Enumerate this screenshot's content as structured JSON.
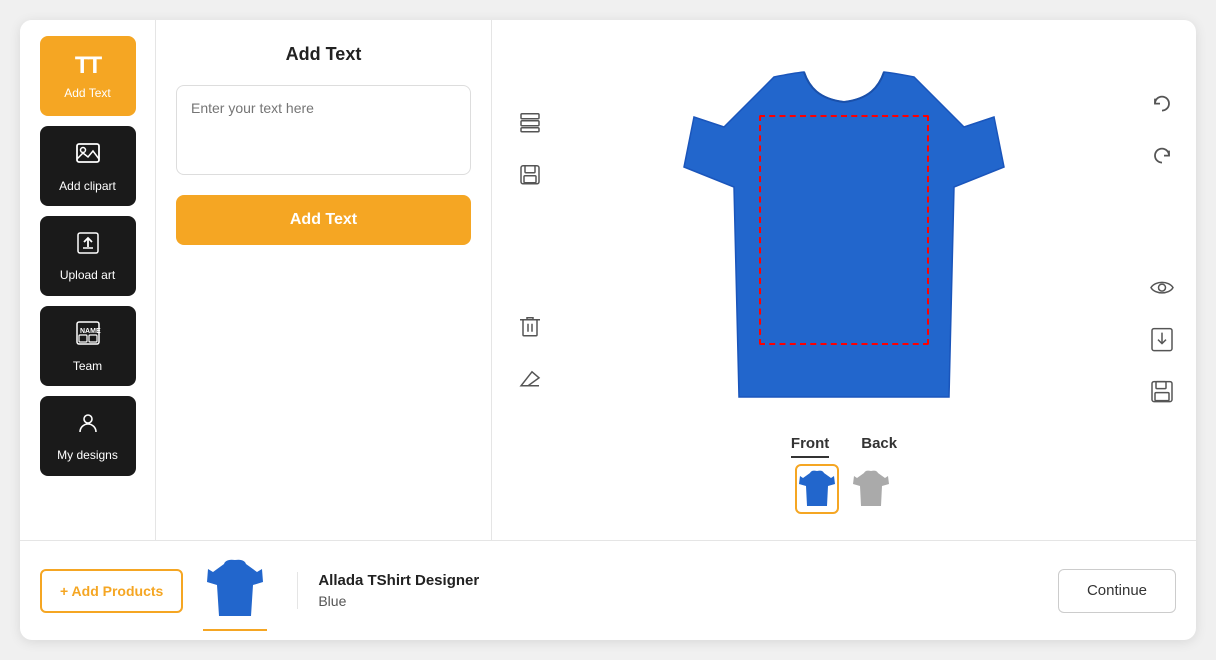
{
  "sidebar": {
    "items": [
      {
        "id": "add-text",
        "label": "Add Text",
        "icon": "TT",
        "active": true,
        "dark": false
      },
      {
        "id": "add-clipart",
        "label": "Add clipart",
        "icon": "🖼",
        "active": false,
        "dark": true
      },
      {
        "id": "upload-art",
        "label": "Upload art",
        "icon": "⬆",
        "active": false,
        "dark": true
      },
      {
        "id": "team",
        "label": "Team",
        "icon": "📋",
        "active": false,
        "dark": true
      },
      {
        "id": "my-designs",
        "label": "My designs",
        "icon": "👤",
        "active": false,
        "dark": true
      }
    ]
  },
  "panel": {
    "title": "Add Text",
    "text_placeholder": "Enter your text here",
    "add_button_label": "Add Text"
  },
  "canvas": {
    "tools_left": [
      {
        "id": "layers",
        "icon": "⊞",
        "label": "layers-icon"
      },
      {
        "id": "save",
        "icon": "💾",
        "label": "save-icon"
      },
      {
        "id": "delete",
        "icon": "🗑",
        "label": "delete-icon"
      },
      {
        "id": "erase",
        "icon": "✏",
        "label": "erase-icon"
      }
    ],
    "tools_right": [
      {
        "id": "undo",
        "icon": "↺",
        "label": "undo-icon"
      },
      {
        "id": "redo",
        "icon": "↻",
        "label": "redo-icon"
      },
      {
        "id": "view",
        "icon": "👁",
        "label": "view-icon"
      },
      {
        "id": "download",
        "icon": "⬇",
        "label": "download-icon"
      },
      {
        "id": "save2",
        "icon": "💾",
        "label": "save2-icon"
      }
    ],
    "view_tabs": [
      {
        "id": "front",
        "label": "Front",
        "active": true
      },
      {
        "id": "back",
        "label": "Back",
        "active": false
      }
    ],
    "color_options": [
      {
        "id": "blue",
        "color": "#2266cc",
        "selected": true
      },
      {
        "id": "gray",
        "color": "#aaaaaa",
        "selected": false
      }
    ]
  },
  "bottom_bar": {
    "add_products_label": "+ Add Products",
    "product_name": "Allada TShirt Designer",
    "product_color": "Blue",
    "continue_label": "Continue"
  }
}
